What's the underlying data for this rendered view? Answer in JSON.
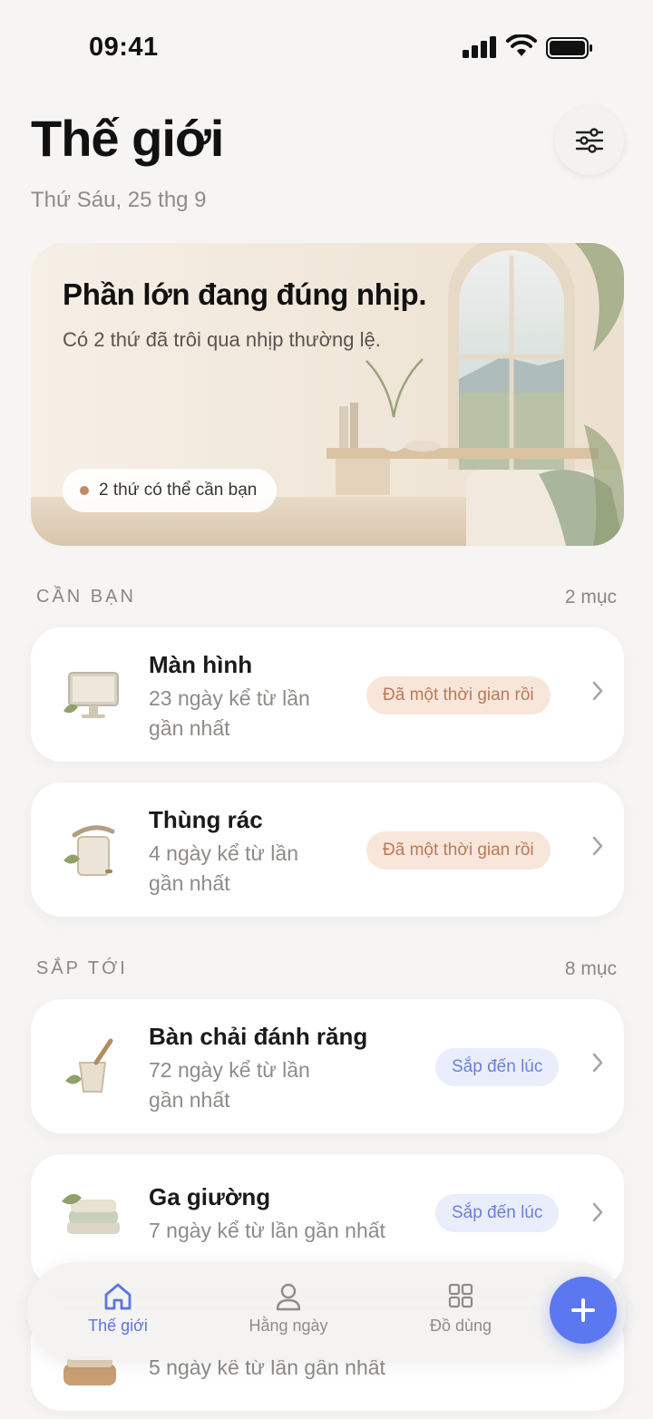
{
  "status": {
    "time": "09:41"
  },
  "header": {
    "title": "Thế giới",
    "date": "Thứ Sáu, 25 thg 9"
  },
  "hero": {
    "title": "Phần lớn đang đúng nhịp.",
    "subtitle": "Có 2 thứ đã trôi qua nhịp thường lệ.",
    "pill": "2 thứ có thể cần bạn"
  },
  "needs_you": {
    "heading": "CẦN BẠN",
    "count": "2 mục",
    "items": [
      {
        "name": "Màn hình",
        "meta": "23 ngày kể từ lần gần nhất",
        "badge": "Đã một thời gian rồi",
        "icon": "monitor-icon"
      },
      {
        "name": "Thùng rác",
        "meta": "4 ngày kể từ lần gần nhất",
        "badge": "Đã một thời gian rồi",
        "icon": "trash-bin-icon"
      }
    ]
  },
  "upcoming": {
    "heading": "SẮP TỚI",
    "count": "8 mục",
    "items": [
      {
        "name": "Bàn chải đánh răng",
        "meta": "72 ngày kể từ lần gần nhất",
        "badge": "Sắp đến lúc",
        "icon": "toothbrush-cup-icon"
      },
      {
        "name": "Ga giường",
        "meta": "7 ngày kể từ lần gần nhất",
        "badge": "Sắp đến lúc",
        "icon": "folded-linens-icon"
      },
      {
        "name": "",
        "meta": "5 ngày kể từ lần gần nhất",
        "badge": "",
        "icon": "tray-icon"
      }
    ]
  },
  "tabs": [
    {
      "label": "Thế giới",
      "icon": "home-icon",
      "active": true
    },
    {
      "label": "Hằng ngày",
      "icon": "person-icon",
      "active": false
    },
    {
      "label": "Đồ dùng",
      "icon": "grid-icon",
      "active": false
    }
  ],
  "colors": {
    "accent": "#5b78f0",
    "warn_badge": "#f8e6da",
    "soon_badge": "#eaedfb"
  }
}
